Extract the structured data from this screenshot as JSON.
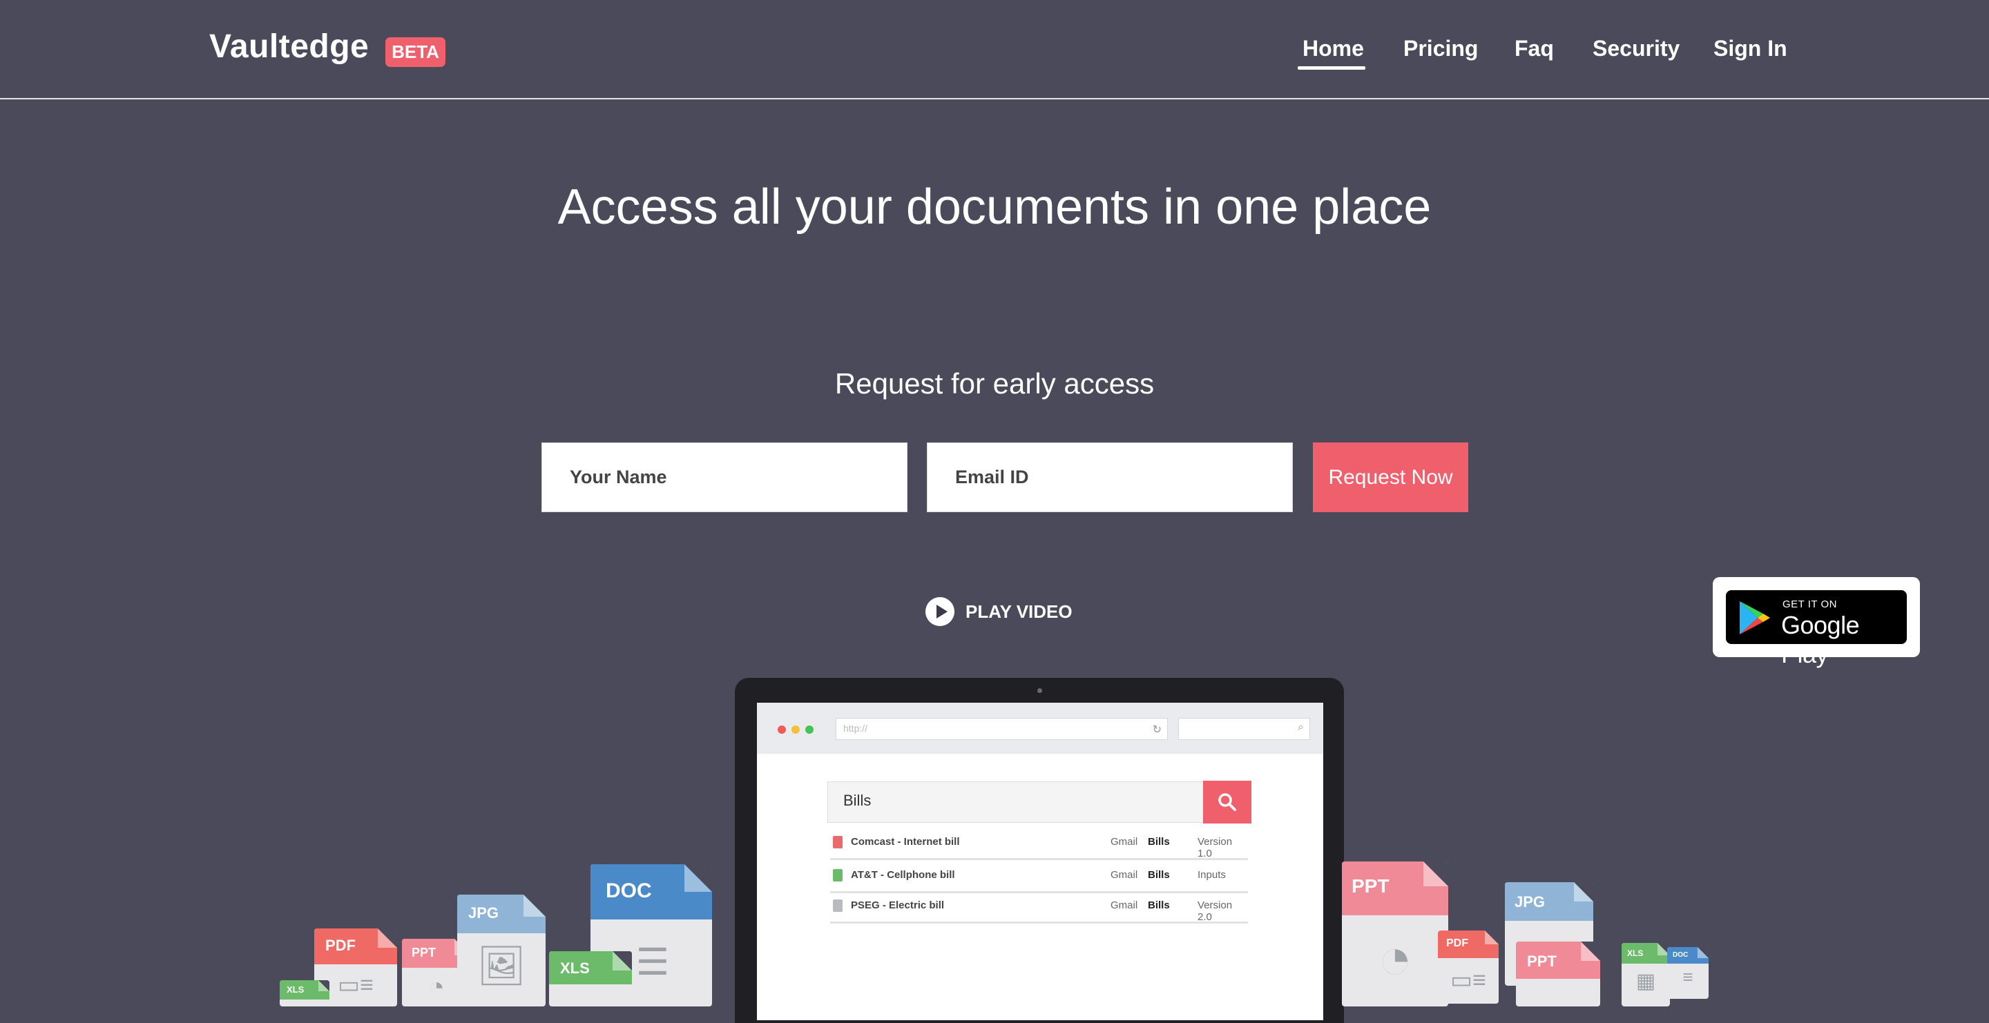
{
  "header": {
    "brand": "Vaultedge",
    "beta": "BETA",
    "nav": [
      "Home",
      "Pricing",
      "Faq",
      "Security",
      "Sign In"
    ],
    "active_nav": "Home"
  },
  "hero": {
    "headline": "Access all your documents in one place",
    "subheading": "Request for early access",
    "form": {
      "name_placeholder": "Your Name",
      "email_placeholder": "Email ID",
      "submit_label": "Request Now"
    },
    "play_video": "PLAY VIDEO"
  },
  "google_play": {
    "small": "GET IT ON",
    "big": "Google Play"
  },
  "laptop": {
    "url": "http://",
    "search_query": "Bills",
    "results": [
      {
        "name": "Comcast - Internet bill",
        "source": "Gmail",
        "category": "Bills",
        "version": "Version 1.0",
        "icon_color": "#e86a6a"
      },
      {
        "name": "AT&T - Cellphone bill",
        "source": "Gmail",
        "category": "Bills",
        "version": "Inputs",
        "icon_color": "#6cbb6a"
      },
      {
        "name": "PSEG - Electric bill",
        "source": "Gmail",
        "category": "Bills",
        "version": "Version 2.0",
        "icon_color": "#b8bcc0"
      }
    ]
  },
  "file_icons": [
    "PDF",
    "PPT",
    "JPG",
    "DOC",
    "XLS",
    "XLS",
    "PPT",
    "PDF",
    "JPG",
    "PPT",
    "XLS",
    "DOC"
  ],
  "colors": {
    "background": "#4b4a5a",
    "accent": "#f0606c",
    "pdf": "#ef6a64",
    "ppt": "#f08a96",
    "jpg": "#8fb4d6",
    "doc": "#4a8ac8",
    "xls": "#6cbb6a"
  }
}
